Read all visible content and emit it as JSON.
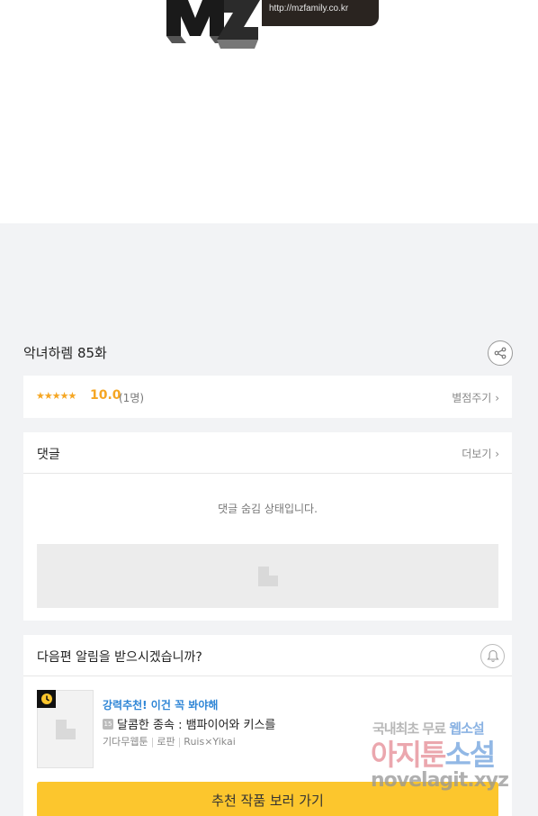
{
  "logo": {
    "url_text": "http://mzfamily.co.kr"
  },
  "episode": {
    "title": "악녀하렘 85화"
  },
  "rating": {
    "stars": "★★★★★",
    "score": "10.0",
    "count": "(1명)",
    "rate_link": "별점주기"
  },
  "comments": {
    "title": "댓글",
    "more_link": "더보기",
    "hidden_message": "댓글 숨김 상태입니다."
  },
  "next_episode": {
    "question": "다음편 알림을 받으시겠습니까?",
    "recommend": {
      "promo": "강력추천! 이건 꼭 봐야해",
      "age_badge": "15",
      "work_title": "달콤한 종속 : 뱀파이어와 키스를",
      "platform": "기다무웹툰",
      "genre": "로판",
      "author": "Ruis×Yikai"
    },
    "cta_label": "추천 작품 보러 가기"
  },
  "watermark": {
    "line1_a": "국내최초 무료",
    "line1_b": "웹소설",
    "line2_a": "아지툰",
    "line2_b": "소설",
    "line3": "novelagit.xyz"
  },
  "colors": {
    "accent": "#fcc62d",
    "star": "#f5a623",
    "link_blue": "#2f86d6"
  }
}
